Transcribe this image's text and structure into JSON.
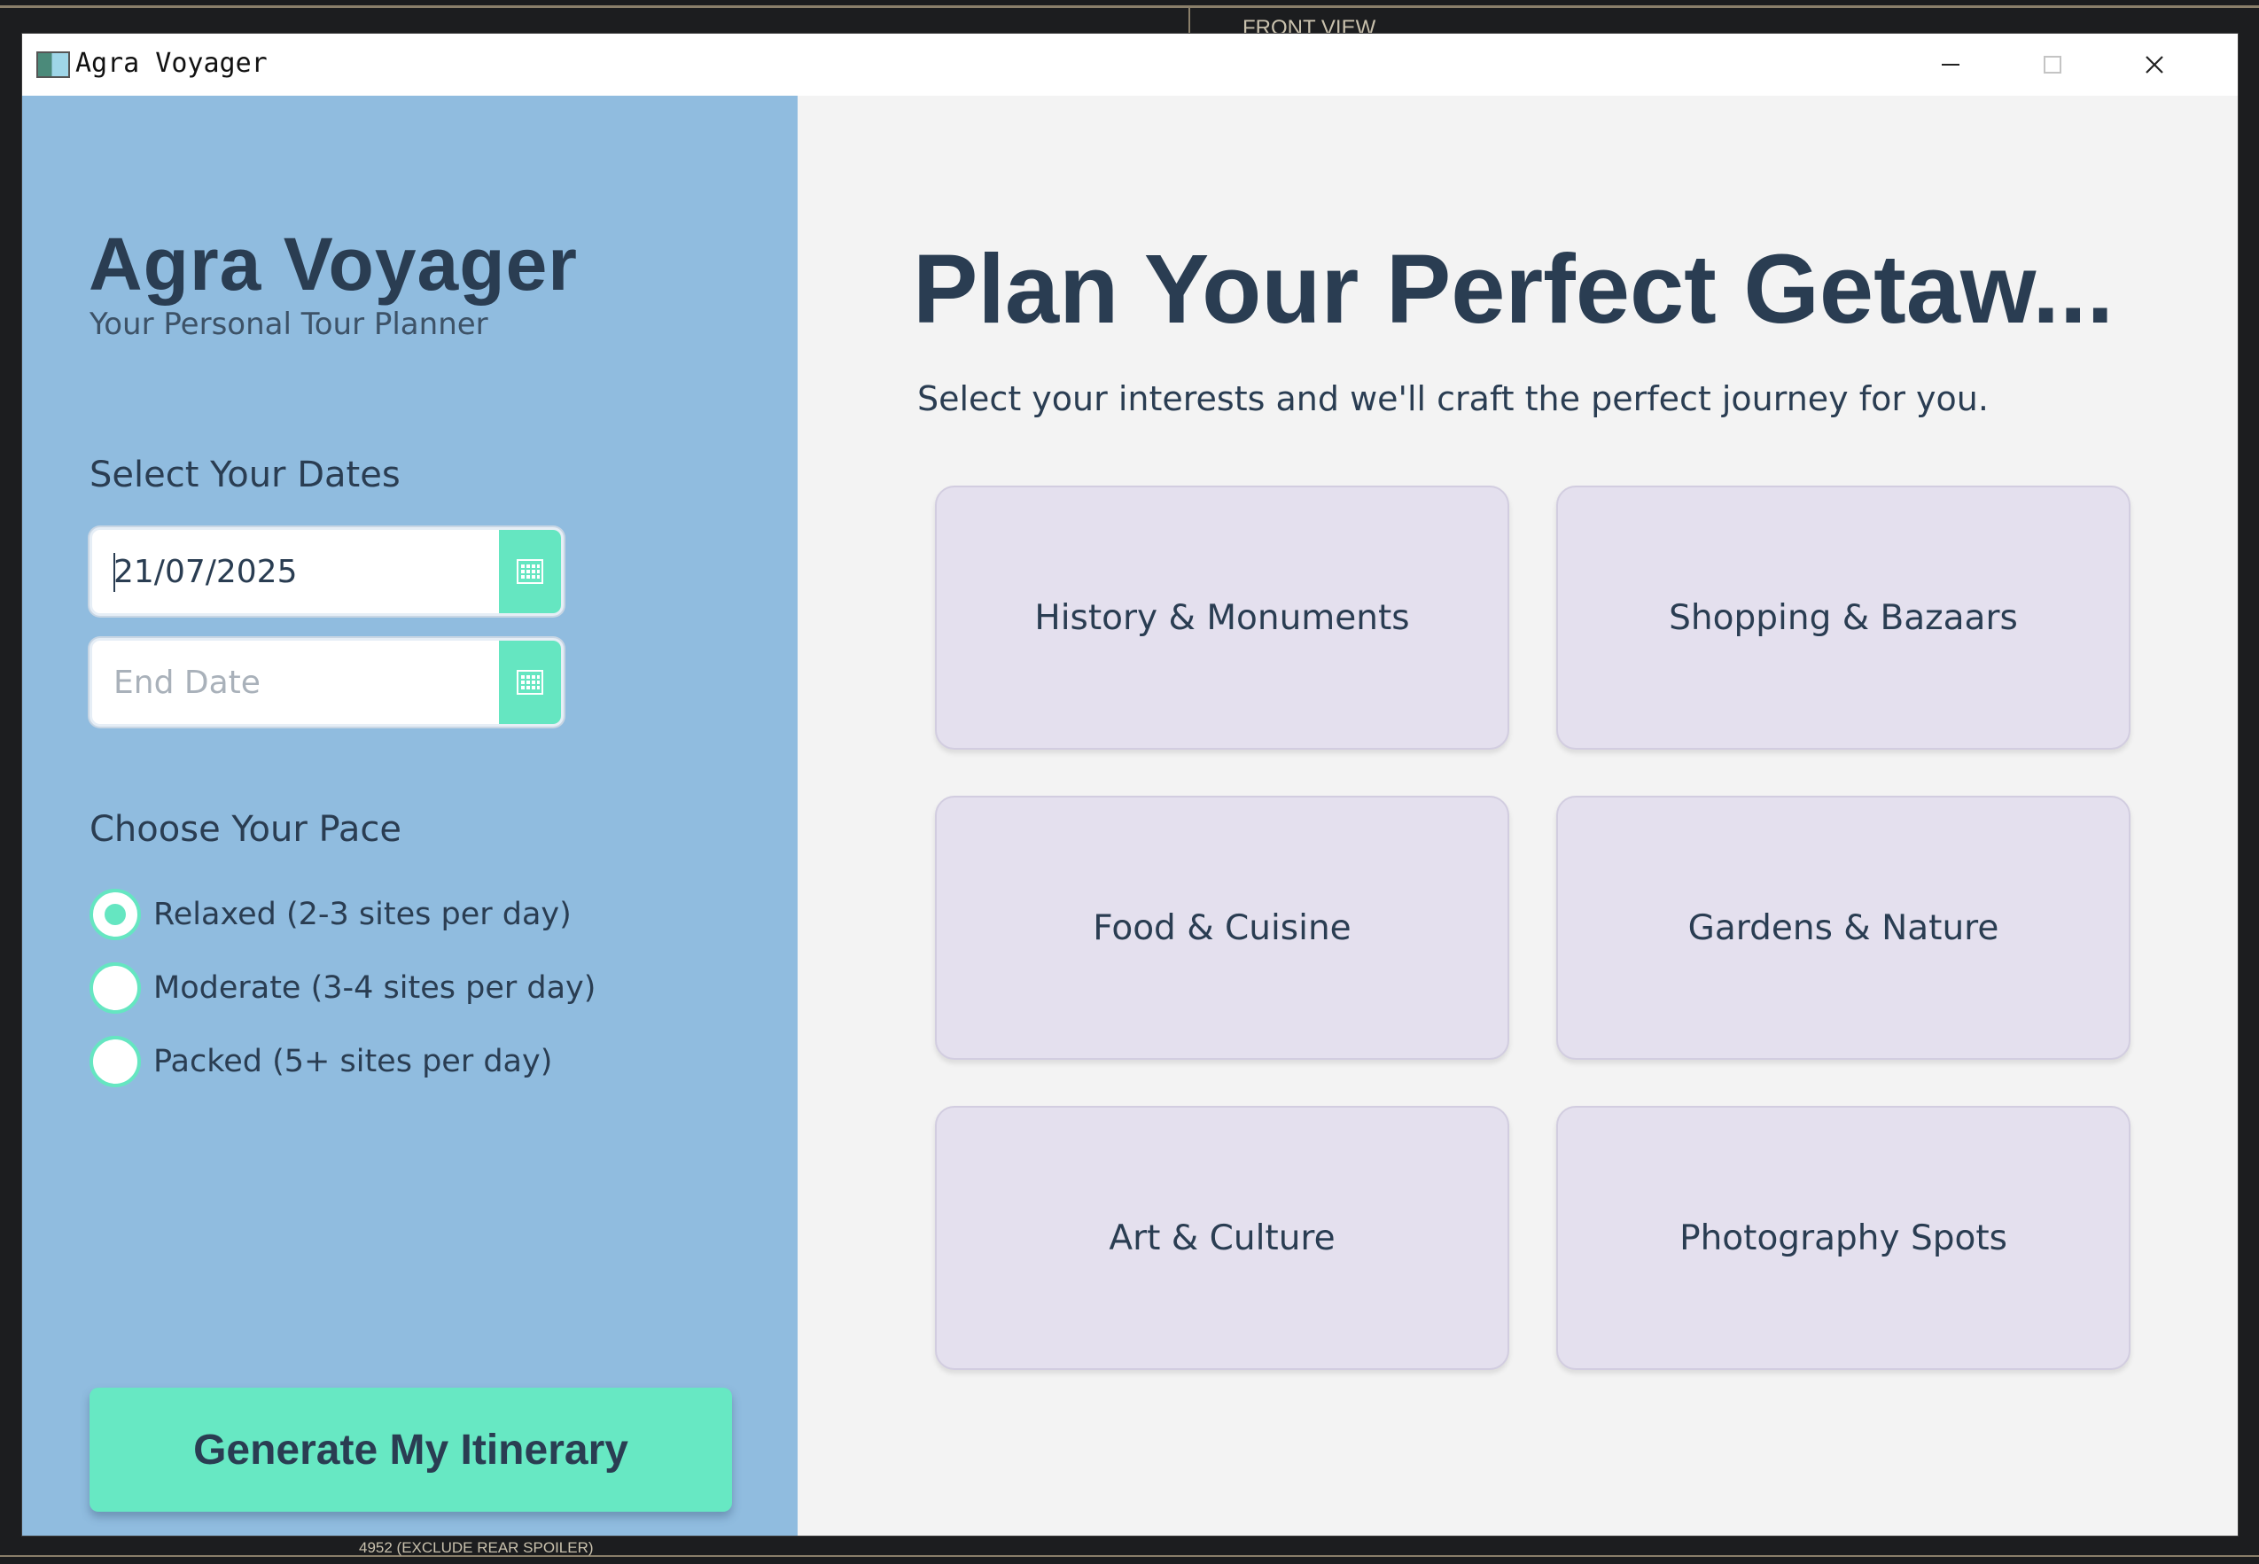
{
  "window": {
    "title": "Agra Voyager",
    "controls": {
      "minimize": "—",
      "maximize": "☐",
      "close": "✕"
    }
  },
  "background": {
    "top_text": "FRONT VIEW",
    "bottom_text": "4952 (EXCLUDE REAR SPOILER)"
  },
  "sidebar": {
    "app_title": "Agra Voyager",
    "app_subtitle": "Your Personal Tour Planner",
    "dates_label": "Select Your Dates",
    "start_date": {
      "value": "21/07/2025",
      "placeholder": ""
    },
    "end_date": {
      "value": "",
      "placeholder": "End Date"
    },
    "calendar_icon": "calendar-icon",
    "pace_label": "Choose Your Pace",
    "pace_options": [
      {
        "label": "Relaxed (2-3 sites per day)",
        "selected": true
      },
      {
        "label": "Moderate (3-4 sites per day)",
        "selected": false
      },
      {
        "label": "Packed (5+ sites per day)",
        "selected": false
      }
    ],
    "generate_label": "Generate My Itinerary"
  },
  "main": {
    "headline": "Plan Your Perfect Getaw...",
    "subhead": "Select your interests and we'll craft the perfect journey for you.",
    "interests": [
      "History & Monuments",
      "Shopping & Bazaars",
      "Food & Cuisine",
      "Gardens & Nature",
      "Art & Culture",
      "Photography Spots"
    ]
  },
  "colors": {
    "sidebar_bg": "#90bcdf",
    "accent": "#65e6c1",
    "text_dark": "#2a3d52",
    "main_bg": "#f3f3f3",
    "card_bg": "#e4e0ee"
  }
}
